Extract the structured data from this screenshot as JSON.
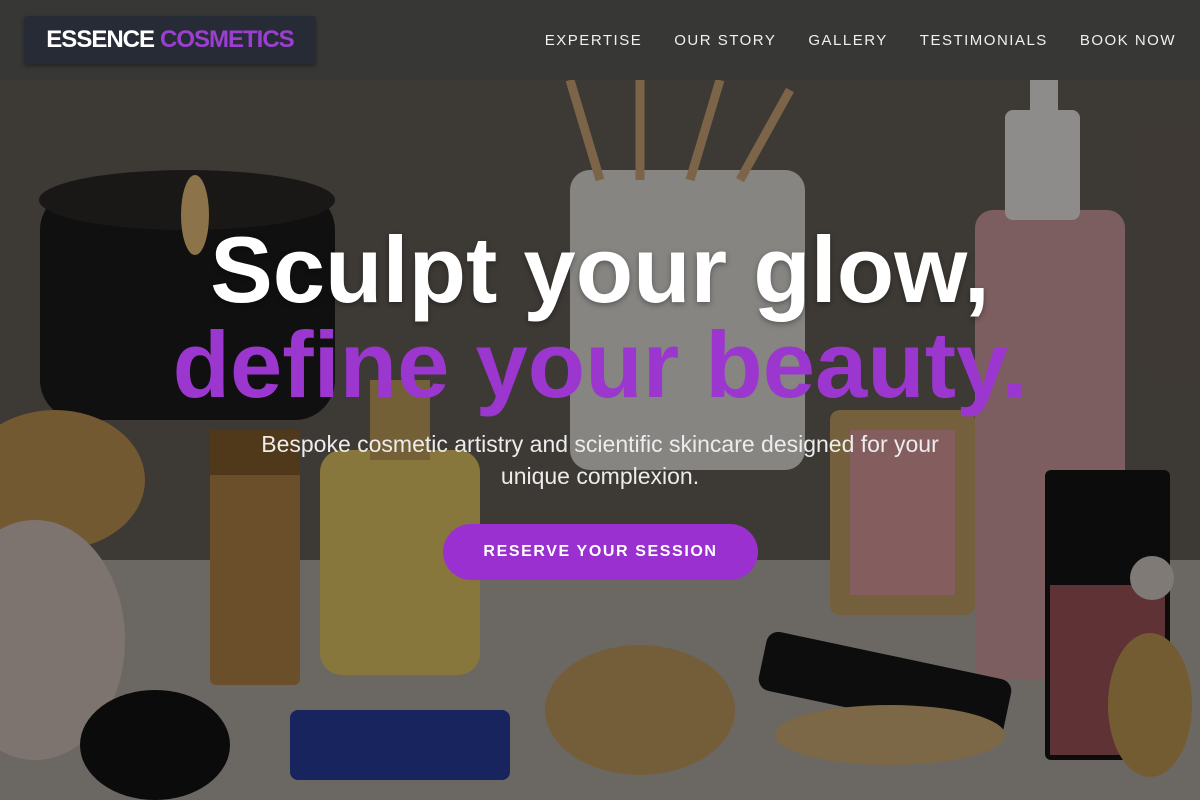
{
  "brand": {
    "name_part1": "ESSENCE",
    "name_part2": "COSMETICS",
    "accent_color": "#9b36cf"
  },
  "nav": {
    "items": [
      {
        "label": "EXPERTISE"
      },
      {
        "label": "OUR STORY"
      },
      {
        "label": "GALLERY"
      },
      {
        "label": "TESTIMONIALS"
      },
      {
        "label": "BOOK NOW"
      }
    ]
  },
  "hero": {
    "headline_line1": "Sculpt your glow,",
    "headline_line2": "define your beauty.",
    "subtitle": "Bespoke cosmetic artistry and scientific skincare designed for your unique complexion.",
    "cta_label": "RESERVE YOUR SESSION",
    "background": "cosmetics-photo"
  }
}
